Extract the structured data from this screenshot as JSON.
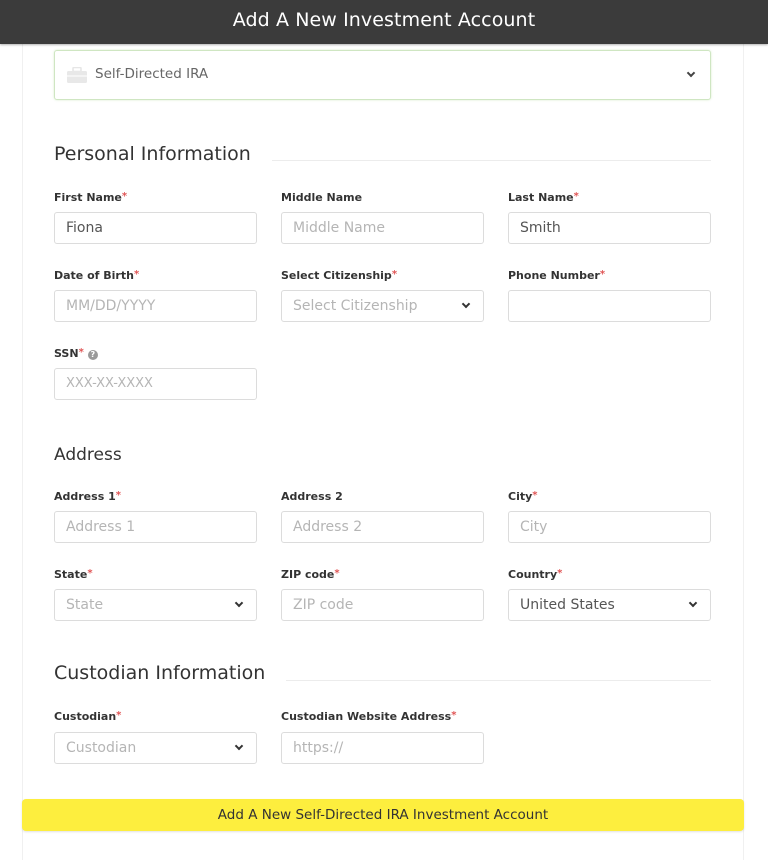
{
  "header": {
    "title": "Add A New Investment Account"
  },
  "account_type": {
    "value": "Self-Directed IRA",
    "icon": "briefcase-icon"
  },
  "personal": {
    "title": "Personal Information",
    "first_name": {
      "label": "First Name",
      "value": "Fiona",
      "required": "*"
    },
    "middle_name": {
      "label": "Middle Name",
      "placeholder": "Middle Name"
    },
    "last_name": {
      "label": "Last Name",
      "value": "Smith",
      "required": "*"
    },
    "dob": {
      "label": "Date of Birth",
      "placeholder": "MM/DD/YYYY",
      "required": "*"
    },
    "citizenship": {
      "label": "Select Citizenship",
      "placeholder": "Select Citizenship",
      "required": "*"
    },
    "phone": {
      "label": "Phone Number",
      "value": "",
      "required": "*"
    },
    "ssn": {
      "label": "SSN",
      "placeholder": "XXX-XX-XXXX",
      "required": "*",
      "help_icon": "?"
    }
  },
  "address": {
    "title": "Address",
    "address1": {
      "label": "Address 1",
      "placeholder": "Address 1",
      "required": "*"
    },
    "address2": {
      "label": "Address 2",
      "placeholder": "Address 2"
    },
    "city": {
      "label": "City",
      "placeholder": "City",
      "required": "*"
    },
    "state": {
      "label": "State",
      "placeholder": "State",
      "required": "*"
    },
    "zip": {
      "label": "ZIP code",
      "placeholder": "ZIP code",
      "required": "*"
    },
    "country": {
      "label": "Country",
      "value": "United States",
      "required": "*"
    }
  },
  "custodian": {
    "title": "Custodian Information",
    "custodian": {
      "label": "Custodian",
      "placeholder": "Custodian",
      "required": "*"
    },
    "website": {
      "label": "Custodian Website Address",
      "placeholder": "https://",
      "required": "*"
    }
  },
  "submit": {
    "label": "Add A New Self-Directed IRA Investment Account"
  },
  "colors": {
    "header_bg": "#3b3b3b",
    "submit_bg": "#fdee3e",
    "required": "#e05555",
    "select_border": "#cfe6c2"
  }
}
